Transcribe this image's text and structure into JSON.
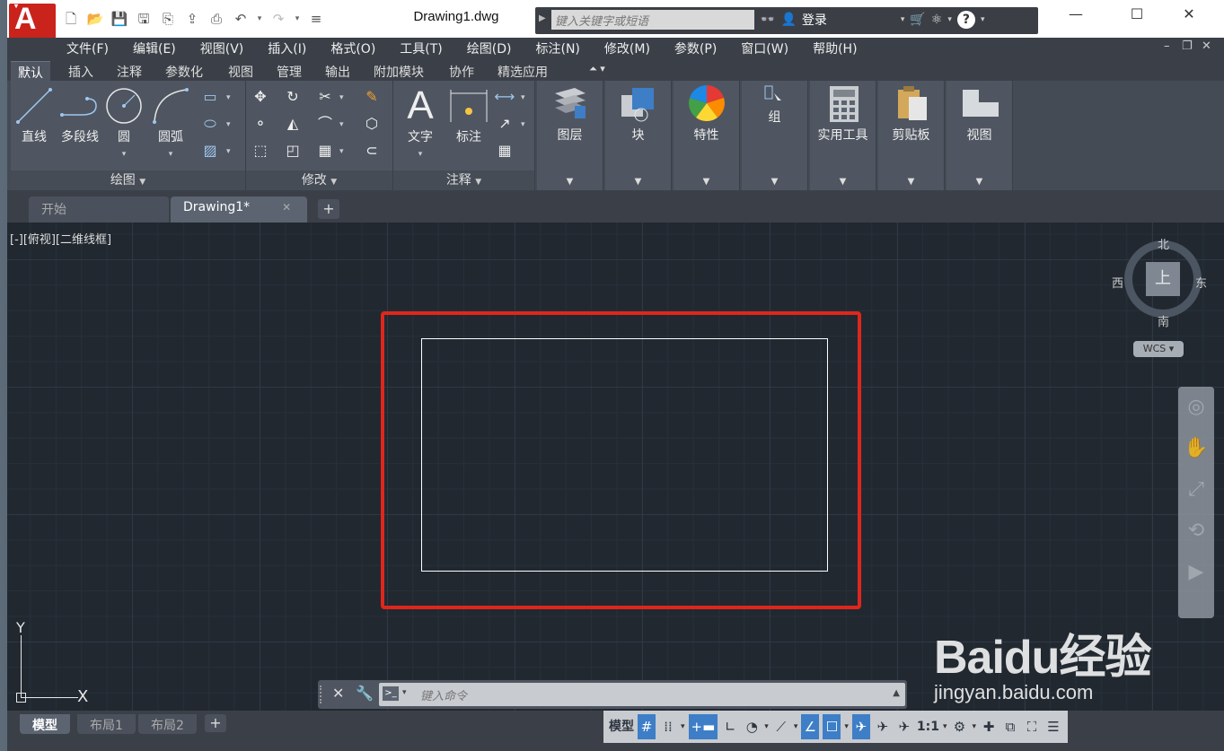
{
  "window": {
    "title": "Drawing1.dwg",
    "search_placeholder": "键入关键字或短语",
    "login_label": "登录"
  },
  "menubar": {
    "items": [
      "文件(F)",
      "编辑(E)",
      "视图(V)",
      "插入(I)",
      "格式(O)",
      "工具(T)",
      "绘图(D)",
      "标注(N)",
      "修改(M)",
      "参数(P)",
      "窗口(W)",
      "帮助(H)"
    ]
  },
  "ribbon_tabs": [
    "默认",
    "插入",
    "注释",
    "参数化",
    "视图",
    "管理",
    "输出",
    "附加模块",
    "协作",
    "精选应用"
  ],
  "ribbon": {
    "draw": {
      "line": "直线",
      "polyline": "多段线",
      "circle": "圆",
      "arc": "圆弧",
      "title": "绘图"
    },
    "modify": {
      "title": "修改"
    },
    "annotation": {
      "text": "文字",
      "dimension": "标注",
      "title": "注释"
    },
    "big_panels": [
      "图层",
      "块",
      "特性",
      "组",
      "实用工具",
      "剪贴板",
      "视图"
    ]
  },
  "file_tabs": {
    "start": "开始",
    "drawing": "Drawing1*"
  },
  "canvas": {
    "view_label": "[-][俯视][二维线框]",
    "viewcube": {
      "north": "北",
      "south": "南",
      "east": "东",
      "west": "西",
      "face": "上"
    },
    "wcs": "WCS",
    "ucs": {
      "x": "X",
      "y": "Y"
    },
    "command_placeholder": "键入命令"
  },
  "layout_tabs": [
    "模型",
    "布局1",
    "布局2"
  ],
  "status": {
    "model": "模型",
    "scale": "1:1"
  },
  "watermark": {
    "brand": "Baidu经验",
    "url": "jingyan.baidu.com"
  },
  "colors": {
    "highlight": "#e0261c",
    "accent": "#3d7ec7",
    "logo": "#c9231c"
  }
}
